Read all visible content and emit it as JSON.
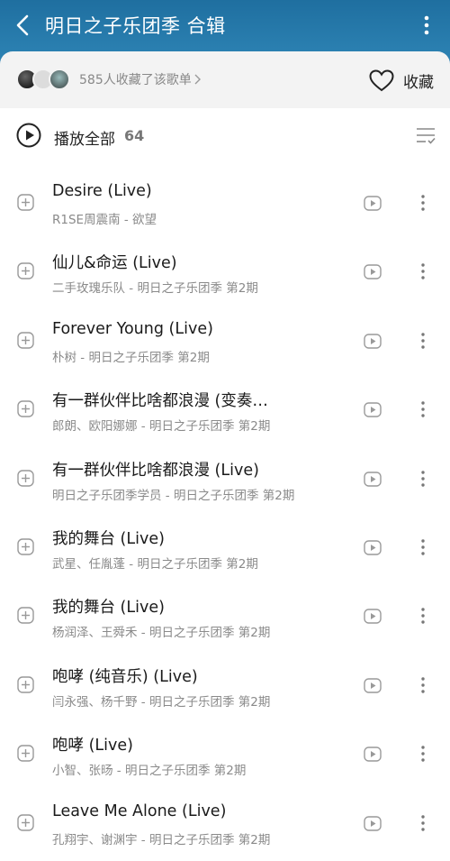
{
  "header": {
    "title": "明日之子乐团季 合辑",
    "back_icon": "chevron-left-icon",
    "more_icon": "more-vertical-icon",
    "colors": {
      "top": "#1f6fa0",
      "bottom": "#3b8dba"
    }
  },
  "collect": {
    "count_text": "585人收藏了该歌单",
    "favorite_label": "收藏",
    "favorite_icon": "heart-outline-icon"
  },
  "play_all": {
    "label": "播放全部",
    "count": "64",
    "play_icon": "play-circle-icon",
    "sort_icon": "list-manage-icon"
  },
  "songs": [
    {
      "title": "Desire (Live)",
      "sub": "R1SE周震南 - 欲望"
    },
    {
      "title": "仙儿&命运 (Live)",
      "sub": "二手玫瑰乐队 - 明日之子乐团季 第2期"
    },
    {
      "title": "Forever Young (Live)",
      "sub": "朴树 - 明日之子乐团季 第2期"
    },
    {
      "title": "有一群伙伴比啥都浪漫 (变奏…",
      "sub": "郎朗、欧阳娜娜 - 明日之子乐团季 第2期"
    },
    {
      "title": "有一群伙伴比啥都浪漫 (Live)",
      "sub": "明日之子乐团季学员 - 明日之子乐团季 第2期"
    },
    {
      "title": "我的舞台 (Live)",
      "sub": "武星、任胤蓬 - 明日之子乐团季 第2期"
    },
    {
      "title": "我的舞台 (Live)",
      "sub": "杨润泽、王舜禾 - 明日之子乐团季 第2期"
    },
    {
      "title": "咆哮 (纯音乐) (Live)",
      "sub": "闫永强、杨千野 - 明日之子乐团季 第2期"
    },
    {
      "title": "咆哮 (Live)",
      "sub": "小智、张旸 - 明日之子乐团季 第2期"
    },
    {
      "title": "Leave Me Alone (Live)",
      "sub": "孔翔宇、谢渊宇 - 明日之子乐团季 第2期"
    }
  ]
}
